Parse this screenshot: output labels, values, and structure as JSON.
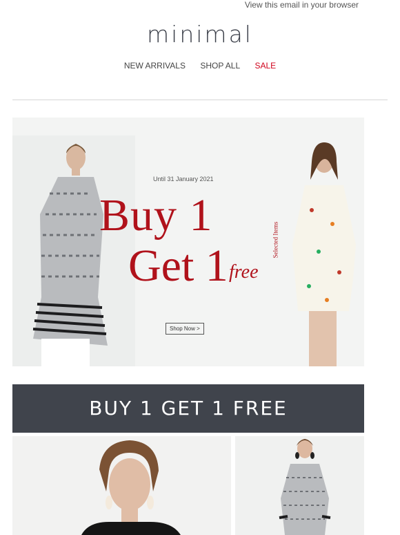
{
  "header": {
    "browser_link": "View this email in your browser",
    "logo": "minimal"
  },
  "nav": {
    "items": [
      {
        "label": "NEW ARRIVALS"
      },
      {
        "label": "SHOP ALL"
      },
      {
        "label": "SALE"
      }
    ]
  },
  "hero": {
    "date": "Until 31 January 2021",
    "line1": "Buy 1",
    "line2": "Get 1",
    "free": "free",
    "selected": "Selected Items",
    "cta": "Shop Now >"
  },
  "banner": {
    "title": "BUY 1 GET 1 FREE"
  },
  "colors": {
    "accent": "#b0121b",
    "sale": "#d0021b",
    "banner_bg": "#40444c"
  }
}
